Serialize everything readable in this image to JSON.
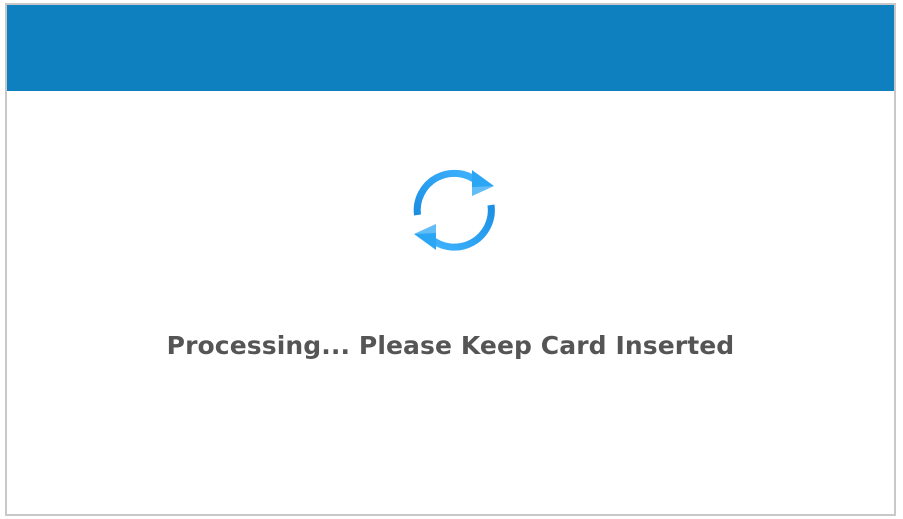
{
  "header": {
    "color": "#0e80bf"
  },
  "spinner": {
    "icon": "refresh-arrows-icon",
    "color": "#1e9bf0"
  },
  "status": {
    "message": "Processing... Please Keep Card Inserted"
  }
}
